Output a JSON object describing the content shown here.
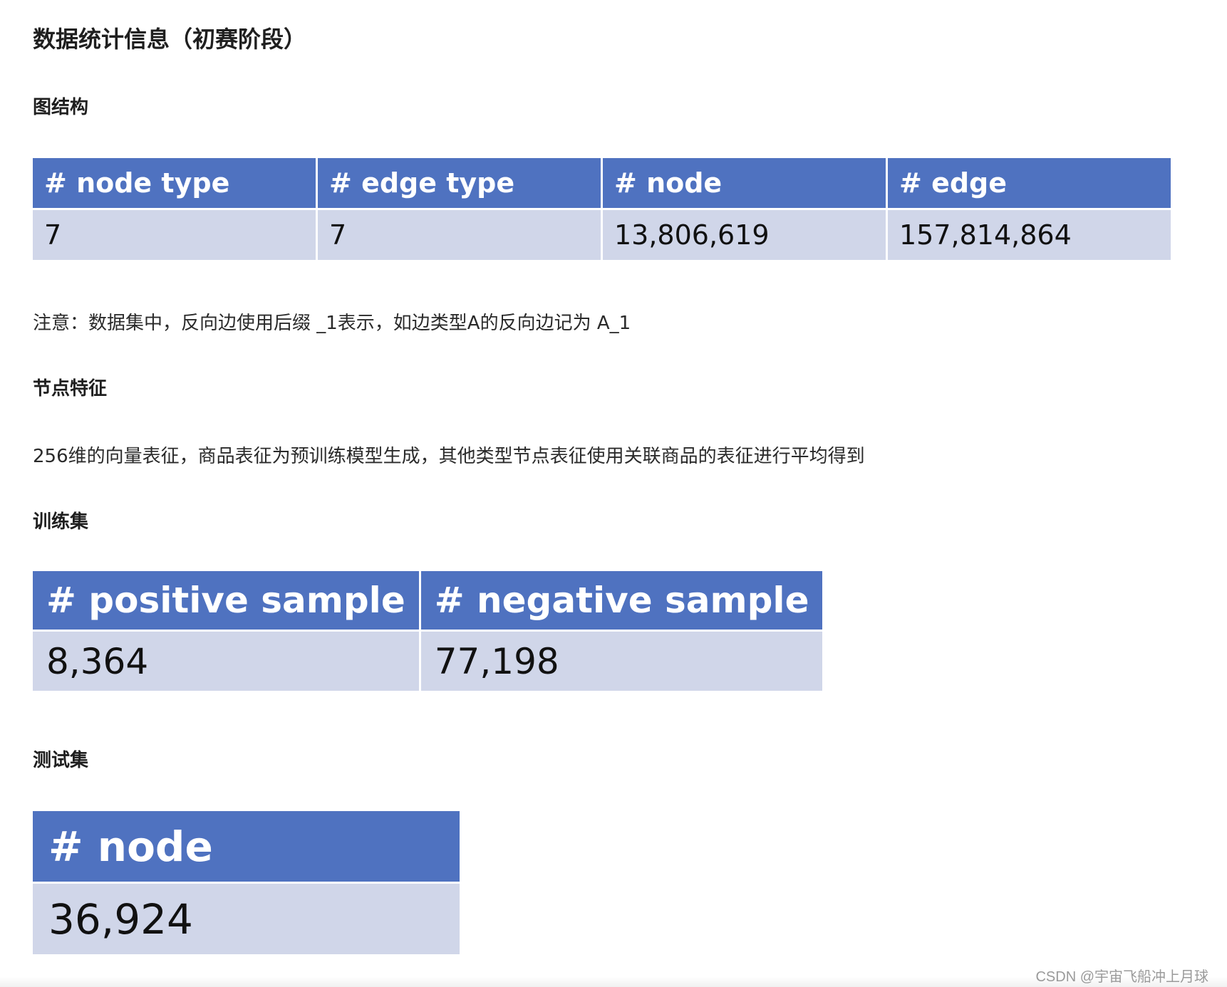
{
  "title": "数据统计信息（初赛阶段）",
  "graph_section": {
    "heading": "图结构",
    "table": {
      "headers": [
        "# node type",
        "# edge type",
        "# node",
        "# edge"
      ],
      "row": [
        "7",
        "7",
        "13,806,619",
        "157,814,864"
      ]
    },
    "note": "注意：数据集中，反向边使用后缀 _1表示，如边类型A的反向边记为 A_1"
  },
  "feature_section": {
    "heading": "节点特征",
    "text": "256维的向量表征，商品表征为预训练模型生成，其他类型节点表征使用关联商品的表征进行平均得到"
  },
  "train_section": {
    "heading": "训练集",
    "table": {
      "headers": [
        "# positive sample",
        "# negative sample"
      ],
      "row": [
        "8,364",
        "77,198"
      ]
    }
  },
  "test_section": {
    "heading": "测试集",
    "table": {
      "headers": [
        "# node"
      ],
      "row": [
        "36,924"
      ]
    }
  },
  "watermark": "CSDN @宇宙飞船冲上月球",
  "colors": {
    "header_bg": "#4f72c0",
    "cell_bg": "#d0d6e9"
  }
}
